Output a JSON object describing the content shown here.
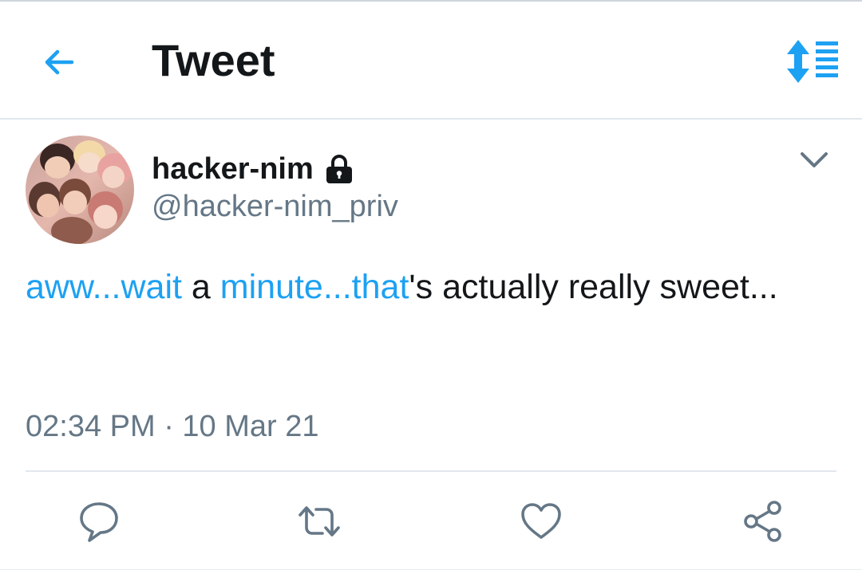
{
  "header": {
    "title": "Tweet",
    "back_icon": "arrow-left-icon",
    "sort_icon": "sort-icon"
  },
  "tweet": {
    "author": {
      "name": "hacker-nim",
      "handle": "@hacker-nim_priv",
      "protected_icon": "lock-icon"
    },
    "text_segments": [
      {
        "text": "aww...wait",
        "link": true
      },
      {
        "text": " a ",
        "link": false
      },
      {
        "text": "minute...that",
        "link": true
      },
      {
        "text": "'s actually really sweet...",
        "link": false
      }
    ],
    "timestamp": "02:34 PM · 10 Mar 21"
  },
  "actions": [
    {
      "icon": "reply-icon"
    },
    {
      "icon": "retweet-icon"
    },
    {
      "icon": "like-icon"
    },
    {
      "icon": "share-icon"
    }
  ],
  "colors": {
    "accent": "#1da1f2",
    "text": "#14171a",
    "secondary": "#657786",
    "divider": "#e1e8ed"
  }
}
